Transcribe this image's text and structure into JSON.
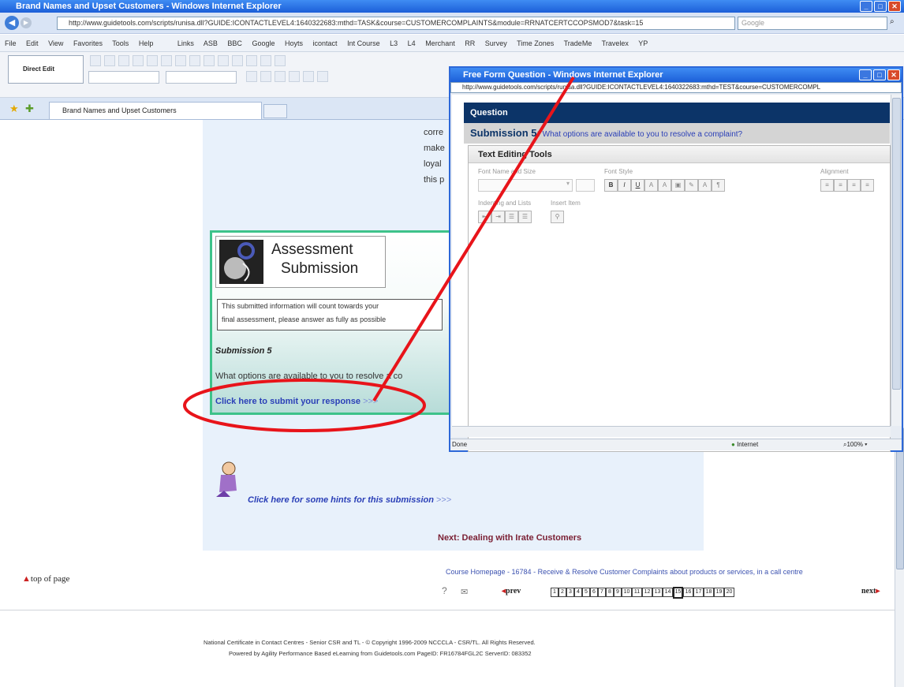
{
  "browser": {
    "title": "Brand Names and Upset Customers - Windows Internet Explorer",
    "address": "http://www.guidetools.com/scripts/runisa.dll?GUIDE:ICONTACTLEVEL4:1640322683:mthd=TASK&course=CUSTOMERCOMPLAINTS&module=RRNATCERTCCOPSMOD7&task=15",
    "search_placeholder": "Google",
    "menus": [
      "File",
      "Edit",
      "View",
      "Favorites",
      "Tools",
      "Help"
    ],
    "links_label": "Links",
    "links": [
      "ASB",
      "BBC",
      "Google",
      "Hoyts",
      "icontact",
      "Int Course",
      "L3",
      "L4",
      "Merchant",
      "RR",
      "Survey",
      "Time Zones",
      "TradeMe",
      "Travelex",
      "YP"
    ],
    "direct_edit": "Direct Edit",
    "tab_label": "Brand Names and Upset Customers"
  },
  "lesson": {
    "body_lines": [
      "corre",
      "make",
      "loyal",
      "this p"
    ],
    "assessment_title_1": "Assessment",
    "assessment_title_2": "Submission",
    "notice_line1": "This submitted information will count towards your",
    "notice_line2": "final assessment, please answer as fully as possible",
    "submission_heading": "Submission 5",
    "question_text": "What options are available to you to resolve a co",
    "submit_link": "Click here to submit your response",
    "submit_arrows": ">>>",
    "hint_link": "Click here for some hints for this submission",
    "hint_arrows": ">>>",
    "next_link": "Next: Dealing with Irate Customers"
  },
  "footer": {
    "top_of_page": "top of page",
    "course_link": "Course Homepage - 16784 - Receive & Resolve Customer Complaints about products or services, in a call centre",
    "prev": "prev",
    "next": "next",
    "pages": [
      "1",
      "2",
      "3",
      "4",
      "5",
      "6",
      "7",
      "8",
      "9",
      "10",
      "11",
      "12",
      "13",
      "14",
      "15",
      "16",
      "17",
      "18",
      "19",
      "20"
    ],
    "current_page": "15",
    "copyright": "National Certificate in Contact Centres - Senior CSR and TL - © Copyright 1996-2009 NCCCLA - CSR/TL. All Rights Reserved.",
    "powered": "Powered by Agility Performance Based eLearning from Guidetools.com PageID: FR16784FGL2C ServerID: 083352"
  },
  "popup": {
    "title": "Free Form Question - Windows Internet Explorer",
    "address": "http://www.guidetools.com/scripts/runisa.dll?GUIDE:ICONTACTLEVEL4:1640322683:mthd=TEST&course=CUSTOMERCOMPL",
    "question_header": "Question",
    "submission_label": "Submission 5:",
    "submission_question": "What options are available to you to resolve a complaint?",
    "editor_title": "Text Editing Tools",
    "font_group": "Font Name and Size",
    "style_group": "Font Style",
    "align_group": "Alignment",
    "indent_group": "Indenting and Lists",
    "insert_group": "Insert Item",
    "status_done": "Done",
    "status_zone": "Internet",
    "status_zoom": "100%"
  },
  "colors": {
    "annotation_red": "#e8141a",
    "ie_blue": "#1c5fd8",
    "question_navy": "#0c3468",
    "assessment_border": "#3ec28a"
  }
}
